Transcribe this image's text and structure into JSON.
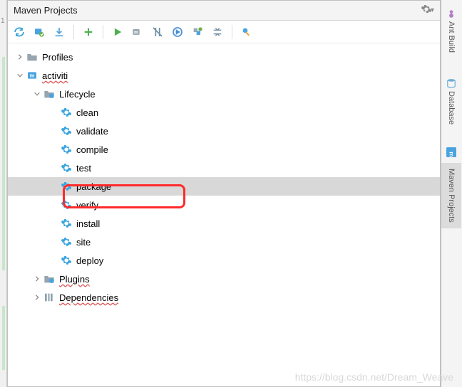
{
  "left_gutter": {
    "line": "1"
  },
  "panel": {
    "title": "Maven Projects"
  },
  "toolbar": {
    "icons": [
      "refresh",
      "generate",
      "download",
      "add",
      "run",
      "skip",
      "offline",
      "exec",
      "profiles",
      "collapse",
      "settings-wrench"
    ]
  },
  "tree": {
    "profiles": {
      "label": "Profiles",
      "squiggle": false
    },
    "project": {
      "label": "activiti",
      "lifecycle": {
        "label": "Lifecycle",
        "goals": [
          "clean",
          "validate",
          "compile",
          "test",
          "package",
          "verify",
          "install",
          "site",
          "deploy"
        ],
        "selected_index": 4
      },
      "plugins": {
        "label": "Plugins"
      },
      "dependencies": {
        "label": "Dependencies"
      }
    }
  },
  "right": {
    "tabs": [
      {
        "label": "Ant Build",
        "active": false
      },
      {
        "label": "Database",
        "active": false
      },
      {
        "label": "",
        "active": false
      },
      {
        "label": "Maven Projects",
        "active": true
      }
    ]
  },
  "watermark": "https://blog.csdn.net/Dream_Weave"
}
